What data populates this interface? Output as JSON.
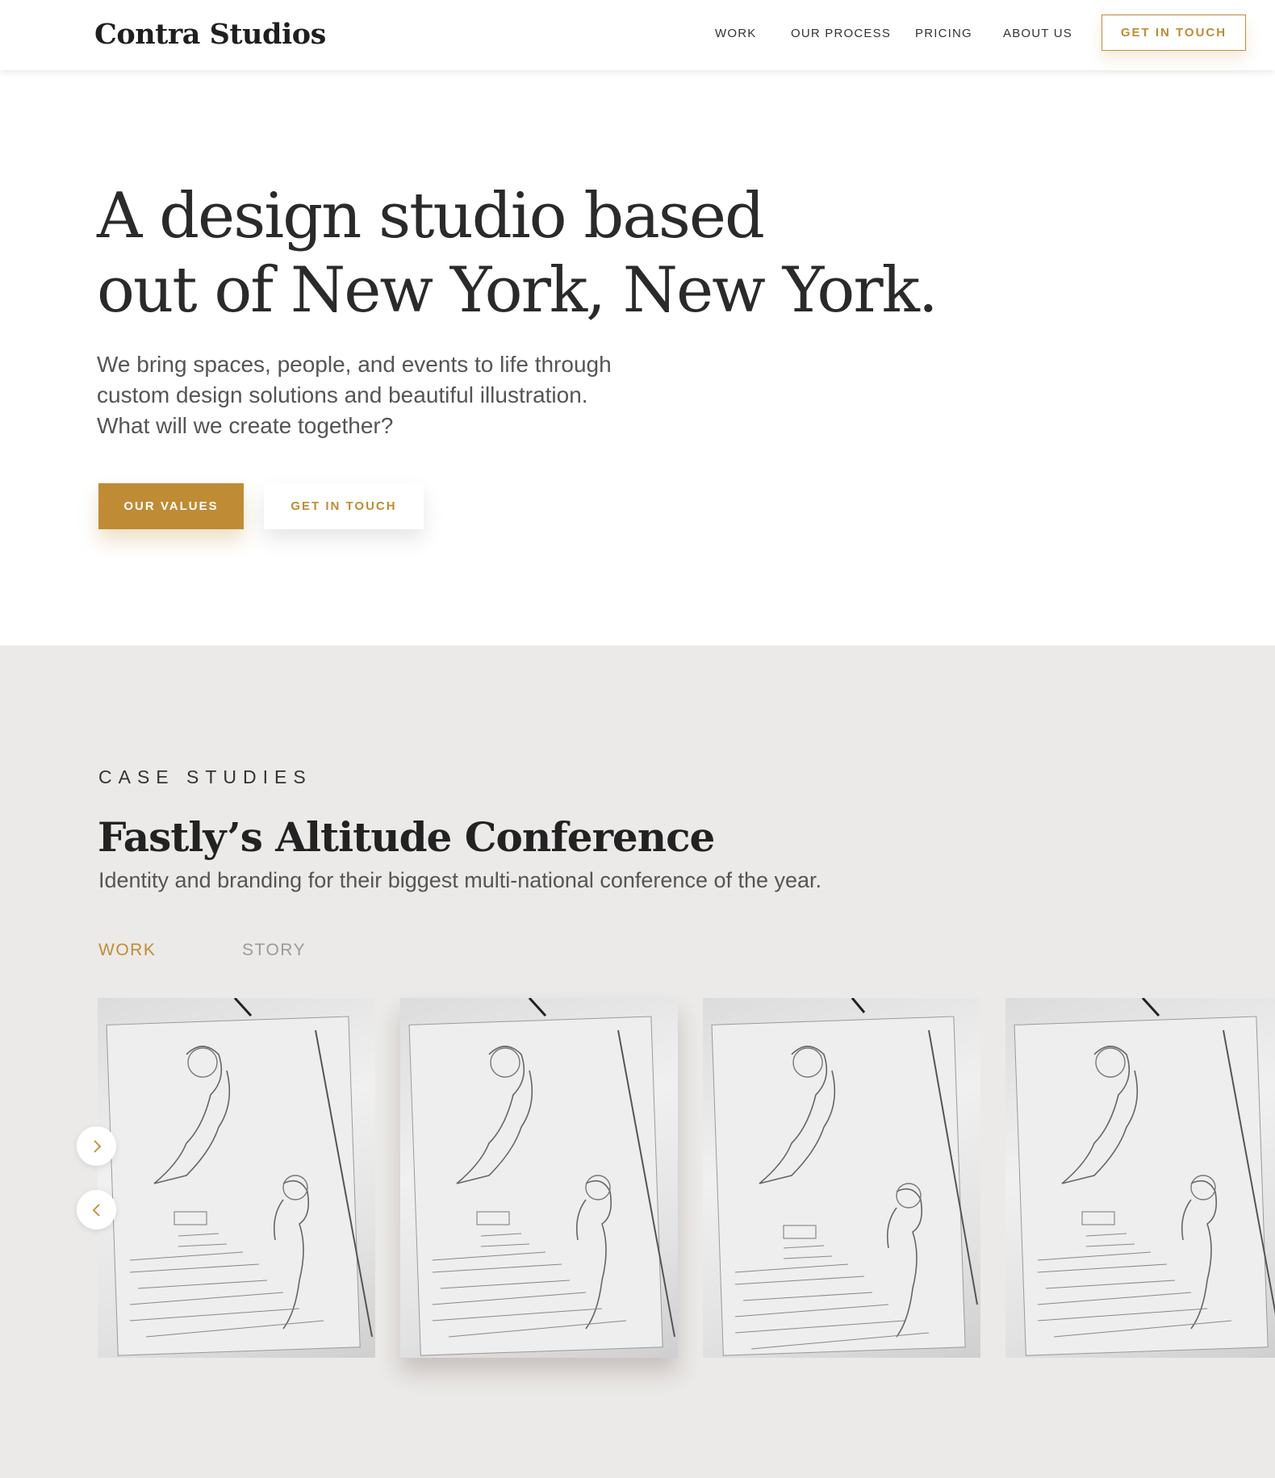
{
  "header": {
    "logo": "Contra Studios",
    "nav": [
      "WORK",
      "OUR PROCESS",
      "PRICING",
      "ABOUT US"
    ],
    "cta": "GET IN TOUCH"
  },
  "hero": {
    "title_line1": "A design studio based",
    "title_line2": "out of New York, New York.",
    "subtitle": "We bring spaces, people, and events to life through custom design solutions and beautiful illustration. What will we create together?",
    "primary_button": "OUR VALUES",
    "secondary_button": "GET IN TOUCH"
  },
  "case_studies": {
    "eyebrow": "CASE STUDIES",
    "title": "Fastly’s Altitude Conference",
    "subtitle": "Identity and branding for their biggest multi-national conference of the year.",
    "tabs": [
      {
        "label": "WORK",
        "active": true
      },
      {
        "label": "STORY",
        "active": false
      }
    ],
    "gallery": {
      "image_count": 4,
      "image_kind": "pencil-sketch-photo",
      "next_icon": "chevron-right-icon",
      "prev_icon": "chevron-left-icon"
    }
  },
  "colors": {
    "accent": "#c08b35",
    "section_bg": "#ebeae8",
    "text_dark": "#222222"
  }
}
